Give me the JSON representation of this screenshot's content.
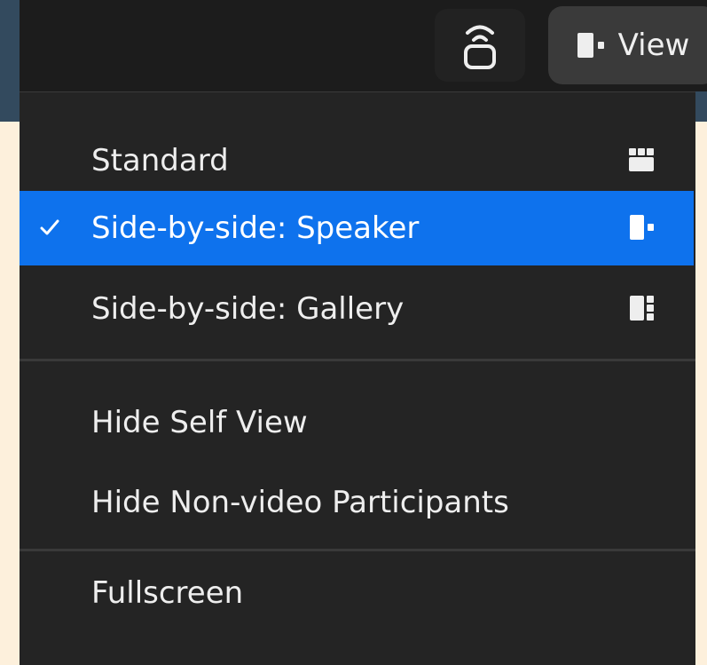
{
  "toolbar": {
    "cast_icon": "remote-control-icon",
    "view_label": "View",
    "view_icon": "speaker-layout-icon"
  },
  "view_menu": {
    "layouts": [
      {
        "label": "Standard",
        "icon": "grid-icon",
        "selected": false
      },
      {
        "label": "Side-by-side: Speaker",
        "icon": "speaker-layout-icon",
        "selected": true
      },
      {
        "label": "Side-by-side: Gallery",
        "icon": "gallery-layout-icon",
        "selected": false
      }
    ],
    "options": [
      {
        "label": "Hide Self View"
      },
      {
        "label": "Hide Non-video Participants"
      }
    ],
    "fullscreen_label": "Fullscreen"
  },
  "colors": {
    "accent": "#0e72ed",
    "menu_bg": "#242424",
    "background": "#fdf0dc"
  }
}
